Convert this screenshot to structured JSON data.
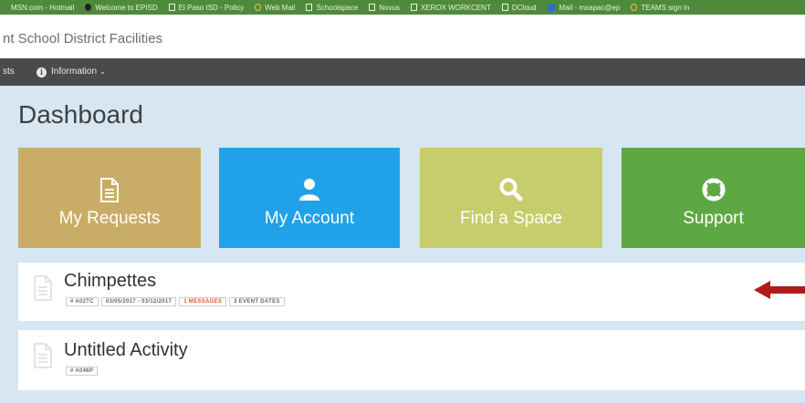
{
  "bookmarks": [
    {
      "label": "MSN.com - Hotmail",
      "icon": "msn-icon"
    },
    {
      "label": "Welcome to EPISD",
      "icon": "globe-icon"
    },
    {
      "label": "El Paso ISD - Policy",
      "icon": "page-icon"
    },
    {
      "label": "Web Mail",
      "icon": "web-mail-icon"
    },
    {
      "label": "Schoolspace",
      "icon": "page-icon"
    },
    {
      "label": "Novus",
      "icon": "page-icon"
    },
    {
      "label": "XEROX WORKCENT",
      "icon": "page-icon"
    },
    {
      "label": "DCloud",
      "icon": "page-icon"
    },
    {
      "label": "Mail - mxapac@ep",
      "icon": "outlook-icon"
    },
    {
      "label": "TEAMS sign in",
      "icon": "teams-icon"
    }
  ],
  "site_title": "nt School District Facilities",
  "nav": {
    "partial_label": "sts",
    "info_label": "Information"
  },
  "dashboard": {
    "title": "Dashboard",
    "tiles": [
      {
        "label": "My Requests",
        "icon": "document-icon",
        "color": "#c9ad66"
      },
      {
        "label": "My Account",
        "icon": "user-icon",
        "color": "#21a1e8"
      },
      {
        "label": "Find a Space",
        "icon": "search-icon",
        "color": "#c7cd6c"
      },
      {
        "label": "Support",
        "icon": "lifebuoy-icon",
        "color": "#5ea843"
      }
    ]
  },
  "requests": [
    {
      "title": "Chimpettes",
      "badges": {
        "id": "# A02TC",
        "dates": "03/05/2017 - 03/12/2017",
        "messages": "1 MESSAGES",
        "event_dates": "2 EVENT DATES"
      }
    },
    {
      "title": "Untitled Activity",
      "badges": {
        "id": "# A046P"
      }
    }
  ],
  "colors": {
    "nav_bg": "#4a4a4a",
    "page_bg": "#d6e6f3",
    "bookmark_bar": "#4f8a3c",
    "arrow": "#b11a1a",
    "message_badge": "#e05a2a"
  }
}
